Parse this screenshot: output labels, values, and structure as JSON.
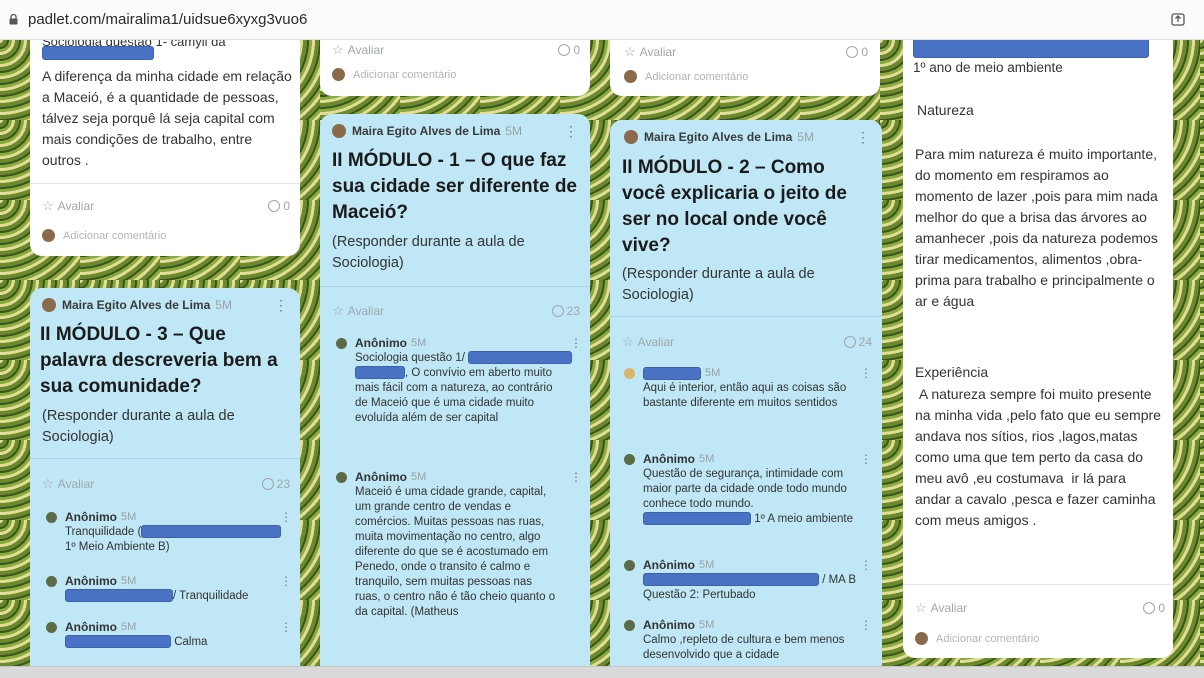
{
  "browser": {
    "url": "padlet.com/mairalima1/uidsue6xyxg3vuo6"
  },
  "col1": {
    "card_top": {
      "partial_title": "Sociologia questão 1- camyll da",
      "text": "A diferença da minha cidade em relação a Maceió, é a quantidade de pessoas, tálvez seja porquê lá seja capital com mais condições de trabalho, entre outros .",
      "rate": "Avaliar",
      "comments": "0",
      "add_comment": "Adicionar comentário"
    },
    "card_m3": {
      "author": "Maira Egito Alves de Lima",
      "time": "5M",
      "title": "II MÓDULO - 3 – Que palavra descreveria bem a sua comunidade?",
      "text": "(Responder durante a aula de Sociologia)",
      "rate": "Avaliar",
      "comments": "23",
      "c1": {
        "name": "Anônimo",
        "time": "5M",
        "line1": "Tranquilidade (",
        "line2": "1º Meio Ambiente B)"
      },
      "c2": {
        "name": "Anônimo",
        "time": "5M",
        "text": "/ Tranquilidade"
      },
      "c3": {
        "name": "Anônimo",
        "time": "5M",
        "text": "Calma"
      }
    }
  },
  "col2": {
    "card_top": {
      "rate": "Avaliar",
      "comments": "0",
      "add_comment": "Adicionar comentário"
    },
    "card_m1": {
      "author": "Maira Egito Alves de Lima",
      "time": "5M",
      "title": "II MÓDULO - 1 – O que faz sua cidade ser diferente de Maceió?",
      "text": "(Responder durante a aula de Sociologia)",
      "rate": "Avaliar",
      "comments": "23",
      "c1": {
        "name": "Anônimo",
        "time": "5M",
        "line1": "Sociologia questão 1/",
        "line2": ", O convívio em aberto muito mais fácil com a natureza, ao contrário de Maceió que é uma cidade muito evoluída além de ser capital"
      },
      "c2": {
        "name": "Anônimo",
        "time": "5M",
        "text": "Maceió é uma cidade grande, capital, um grande centro de vendas e comércios. Muitas pessoas nas ruas, muita movimentação no centro, algo diferente do que se é acostumado em Penedo, onde o transito é calmo e tranquilo, sem muitas pessoas nas ruas, o centro não é tão cheio quanto o da capital. (Matheus"
      }
    }
  },
  "col3": {
    "card_top": {
      "rate": "Avaliar",
      "comments": "0",
      "add_comment": "Adicionar comentário"
    },
    "card_m2": {
      "author": "Maira Egito Alves de Lima",
      "time": "5M",
      "title": "II MÓDULO - 2 – Como você explicaria o jeito de ser no local onde você vive?",
      "text": "(Responder durante a aula de Sociologia)",
      "rate": "Avaliar",
      "comments": "24",
      "c1": {
        "time": "5M",
        "text": "Aqui é interior, então aqui as coisas são bastante diferente em muitos sentidos"
      },
      "c2": {
        "name": "Anônimo",
        "time": "5M",
        "text": "Questão de segurança, intimidade com maior parte da cidade onde todo mundo conhece todo mundo.",
        "tail": "1º A meio ambiente"
      },
      "c3": {
        "name": "Anônimo",
        "time": "5M",
        "line1": "/ MA B",
        "line2": "Questão 2: Pertubado"
      },
      "c4": {
        "name": "Anônimo",
        "time": "5M",
        "text": "Calmo ,repleto de cultura e bem menos desenvolvido que a cidade"
      }
    }
  },
  "col4": {
    "card": {
      "subtitle": "1º ano de  meio ambiente",
      "heading1": "Natureza",
      "para1": "Para mim natureza é muito importante, do momento em respiramos ao momento de lazer ,pois para mim nada melhor do que a brisa das árvores ao amanhecer ,pois da natureza podemos tirar medicamentos, alimentos ,obra-prima para trabalho e principalmente o ar e água",
      "heading2": "Experiência",
      "para2": " A natureza sempre foi muito presente na minha vida ,pelo fato que eu sempre andava nos sítios, rios ,lagos,matas como uma que tem perto da casa do meu avô ,eu costumava  ir lá para andar a cavalo ,pesca e fazer caminha com meus amigos .",
      "rate": "Avaliar",
      "comments": "0",
      "add_comment": "Adicionar comentário"
    }
  }
}
